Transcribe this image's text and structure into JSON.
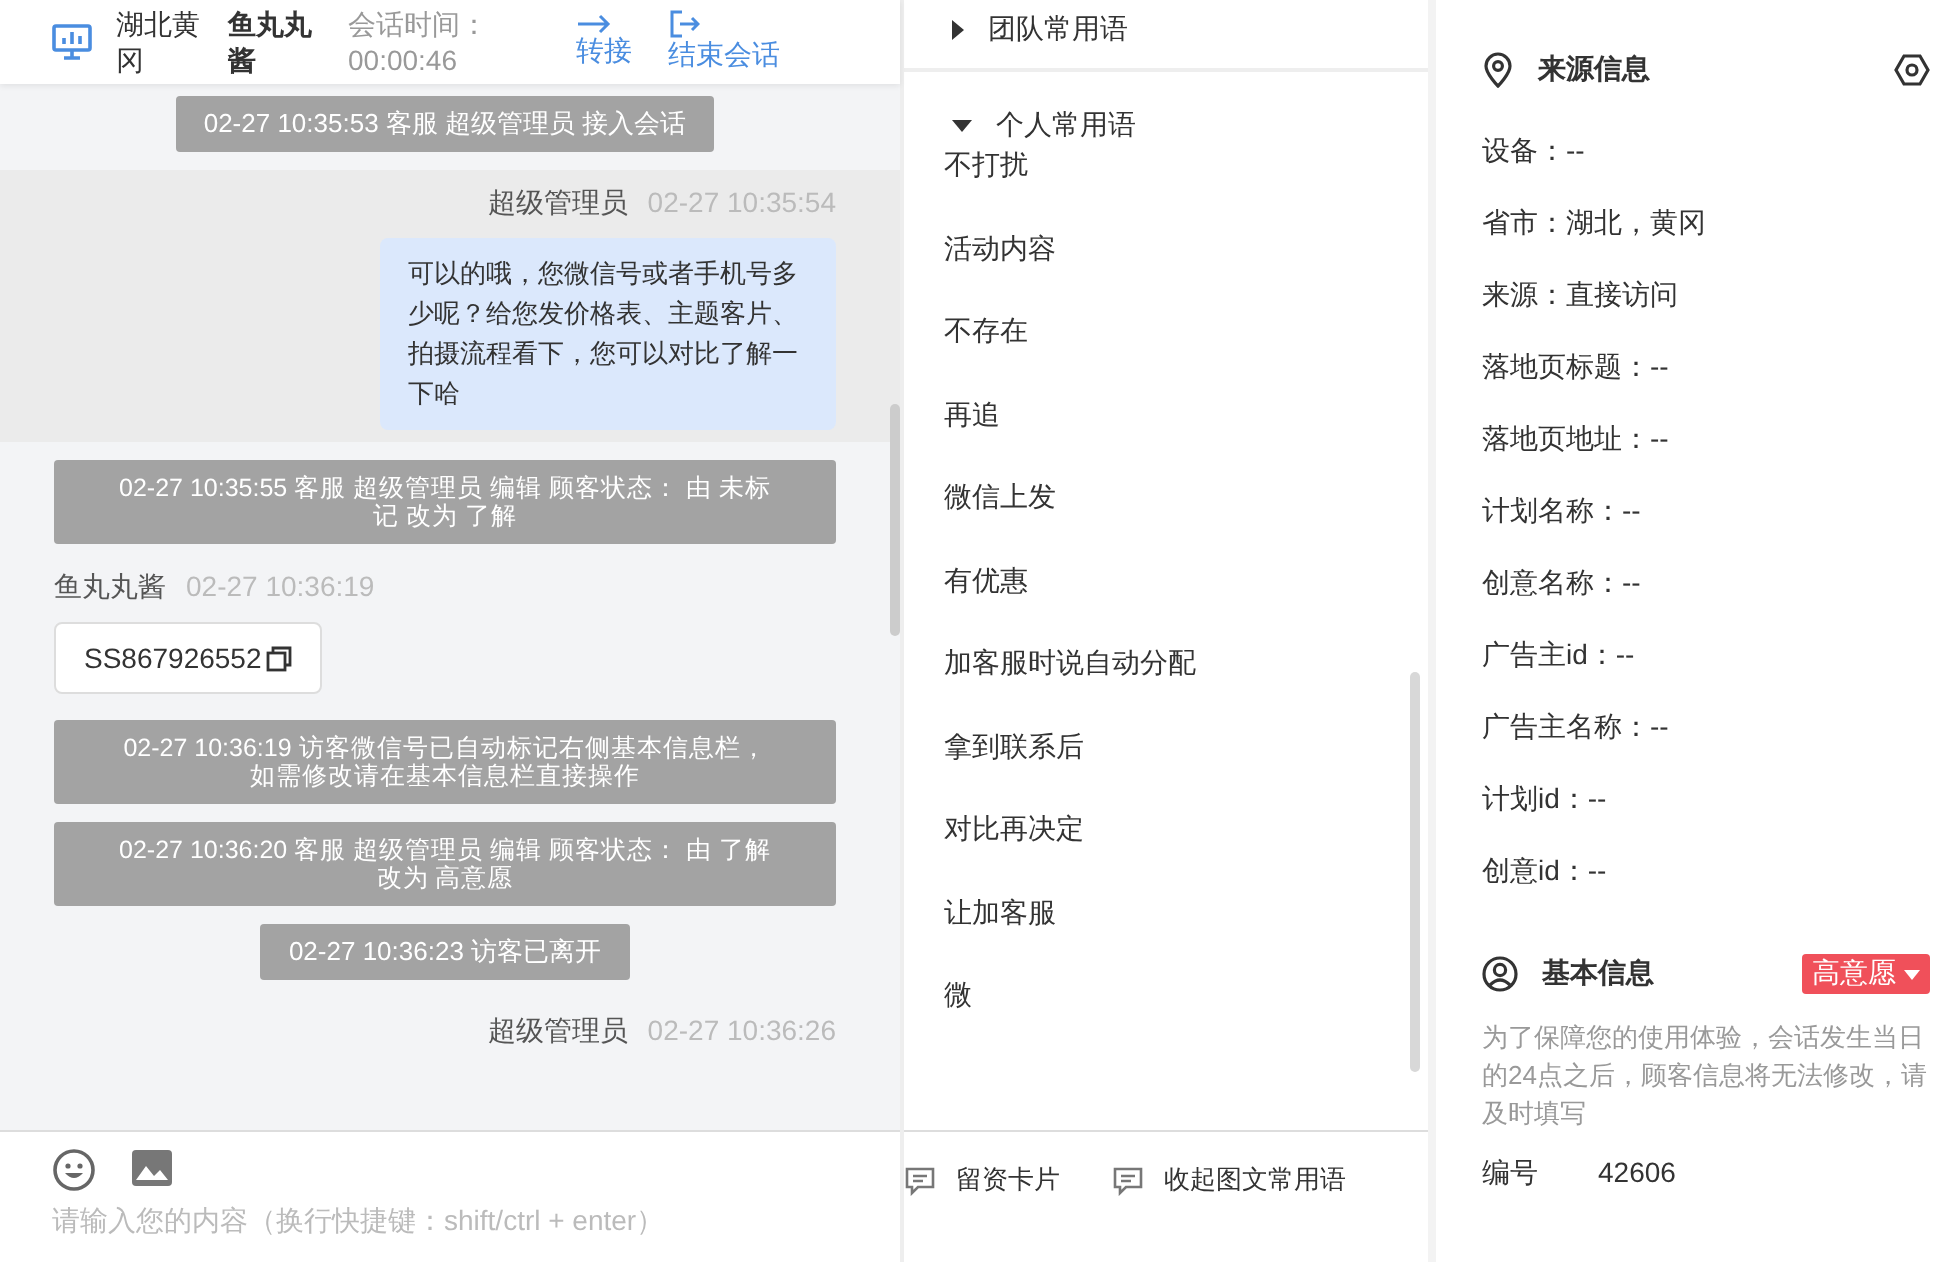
{
  "header": {
    "location": "湖北黄冈",
    "visitor": "鱼丸丸酱",
    "duration_label": "会话时间：",
    "duration": "00:00:46",
    "actions": [
      {
        "kind": "transfer",
        "label": "转接"
      },
      {
        "kind": "end",
        "label": "结束会话"
      }
    ]
  },
  "messages": [
    {
      "kind": "system",
      "text": "02-27 10:35:53 客服 超级管理员 接入会话"
    },
    {
      "kind": "agent",
      "sender": "超级管理员",
      "time": "02-27 10:35:54",
      "text": "可以的哦，您微信号或者手机号多少呢？给您发价格表、主题客片、拍摄流程看下，您可以对比了解一下哈"
    },
    {
      "kind": "system",
      "lines": [
        "02-27 10:35:55 客服 超级管理员 编辑 顾客状态： 由 未标",
        "记 改为 了解"
      ]
    },
    {
      "kind": "visitor",
      "sender": "鱼丸丸酱",
      "time": "02-27 10:36:19",
      "text": "SS867926552"
    },
    {
      "kind": "system",
      "lines": [
        "02-27 10:36:19 访客微信号已自动标记右侧基本信息栏，",
        "如需修改请在基本信息栏直接操作"
      ]
    },
    {
      "kind": "system",
      "lines": [
        "02-27 10:36:20 客服 超级管理员 编辑 顾客状态： 由 了解",
        "改为 高意愿"
      ]
    },
    {
      "kind": "system",
      "text": "02-27 10:36:23 访客已离开"
    },
    {
      "kind": "agent",
      "sender": "超级管理员",
      "time": "02-27 10:36:26"
    }
  ],
  "composer": {
    "placeholder": "请输入您的内容（换行快捷键：shift/ctrl + enter）"
  },
  "phrases": {
    "groups": [
      {
        "title": "团队常用语",
        "expanded": false
      },
      {
        "title": "个人常用语",
        "expanded": true,
        "items": [
          "不打扰",
          "活动内容",
          "不存在",
          "再追",
          "微信上发",
          "有优惠",
          "加客服时说自动分配",
          "拿到联系后",
          "对比再决定",
          "让加客服",
          "微"
        ]
      }
    ],
    "buttons": [
      "留资卡片",
      "收起图文常用语"
    ]
  },
  "source_info": {
    "title": "来源信息",
    "rows": [
      "设备：--",
      "省市：湖北，黄冈",
      "来源：直接访问",
      "落地页标题：--",
      "落地页地址：--",
      "计划名称：--",
      "创意名称：--",
      "广告主id：--",
      "广告主名称：--",
      "计划id：--",
      "创意id：--"
    ]
  },
  "basic_info": {
    "title": "基本信息",
    "status": "高意愿",
    "note": "为了保障您的使用体验，会话发生当日的24点之后，顾客信息将无法修改，请及时填写",
    "fields": [
      {
        "label": "编号",
        "value": "42606"
      }
    ]
  }
}
